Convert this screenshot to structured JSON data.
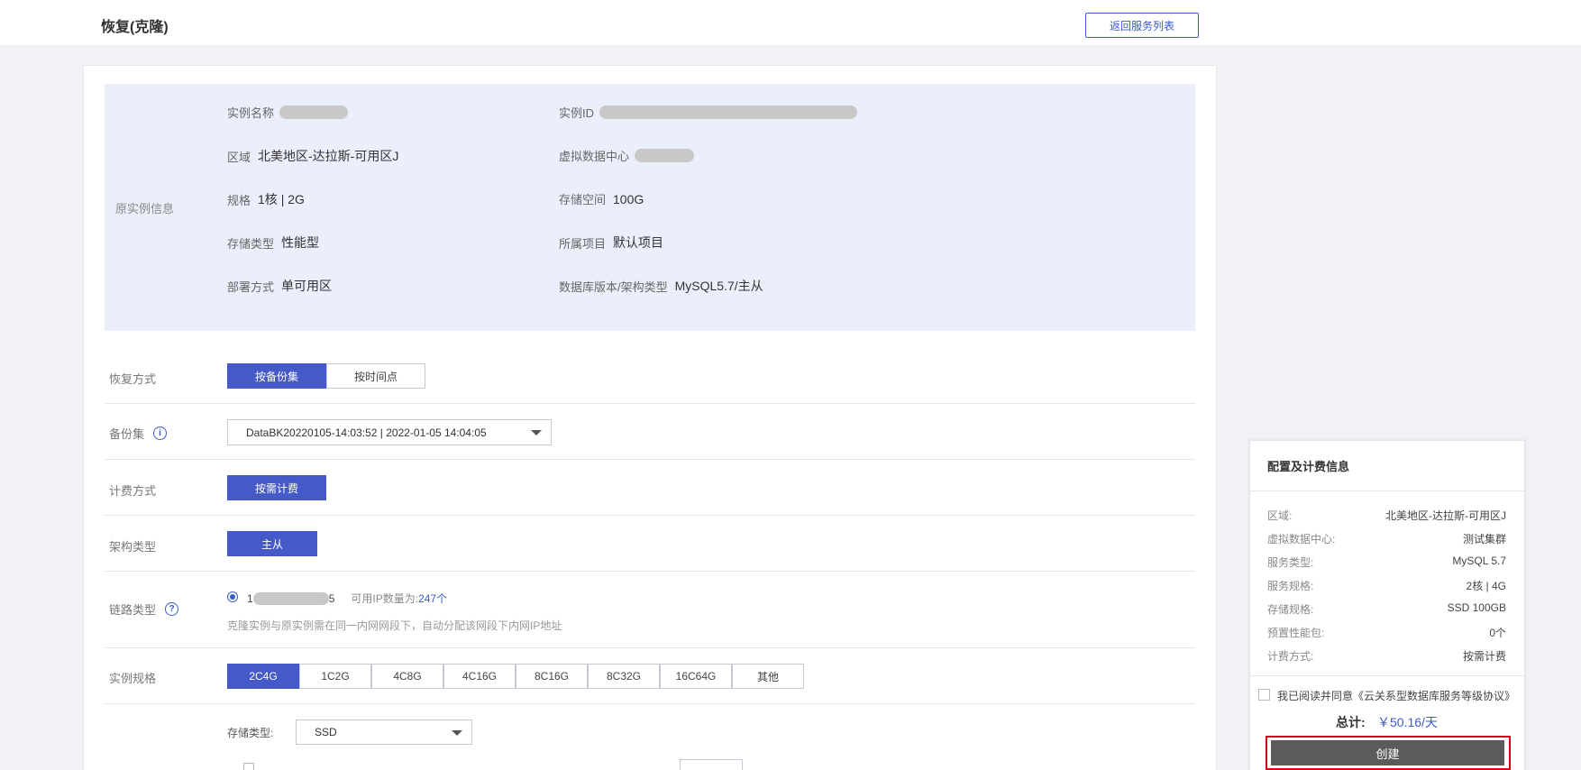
{
  "page": {
    "title": "恢复(克隆)",
    "back_label": "返回服务列表"
  },
  "original": {
    "section_label": "原实例信息",
    "instance_name_label": "实例名称",
    "instance_id_label": "实例ID",
    "region_label": "区域",
    "region_value": "北美地区-达拉斯-可用区J",
    "vdc_label": "虚拟数据中心",
    "spec_label": "规格",
    "spec_value": "1核 | 2G",
    "storage_label": "存储空间",
    "storage_value": "100G",
    "storage_type_label": "存储类型",
    "storage_type_value": "性能型",
    "project_label": "所属项目",
    "project_value": "默认项目",
    "deploy_label": "部署方式",
    "deploy_value": "单可用区",
    "db_version_label": "数据库版本/架构类型",
    "db_version_value": "MySQL5.7/主从"
  },
  "form": {
    "restore_label": "恢复方式",
    "restore_options": [
      "按备份集",
      "按时间点"
    ],
    "backup_label": "备份集",
    "backup_value": "DataBK20220105-14:03:52 | 2022-01-05 14:04:05",
    "billing_label": "计费方式",
    "billing_option": "按需计费",
    "arch_label": "架构类型",
    "arch_option": "主从",
    "link_label": "链路类型",
    "link_prefix": "1",
    "link_suffix": "5",
    "link_ip_label": "可用IP数量为:",
    "link_ip_count": "247个",
    "link_hint": "克隆实例与原实例需在同一内网网段下，自动分配该网段下内网IP地址",
    "spec_label": "实例规格",
    "spec_options": [
      "2C4G",
      "1C2G",
      "4C8G",
      "4C16G",
      "8C16G",
      "8C32G",
      "16C64G",
      "其他"
    ],
    "storage_type_label": "存储类型:",
    "storage_type_value": "SSD"
  },
  "summary": {
    "title": "配置及计费信息",
    "items": [
      {
        "k": "区域:",
        "v": "北美地区-达拉斯-可用区J"
      },
      {
        "k": "虚拟数据中心:",
        "v": "测试集群"
      },
      {
        "k": "服务类型:",
        "v": "MySQL 5.7"
      },
      {
        "k": "服务规格:",
        "v": "2核 | 4G"
      },
      {
        "k": "存储规格:",
        "v": "SSD 100GB"
      },
      {
        "k": "预置性能包:",
        "v": "0个"
      },
      {
        "k": "计费方式:",
        "v": "按需计费"
      }
    ],
    "agree_text": "我已阅读并同意《云关系型数据库服务等级协议》",
    "total_label": "总计:",
    "total_value": "￥50.16/天",
    "create_label": "创建"
  },
  "colors": {
    "primary": "#4659c9",
    "panel": "#ebeefb",
    "highlight_border": "#d9001b",
    "create_bg": "#5b5b5b"
  }
}
